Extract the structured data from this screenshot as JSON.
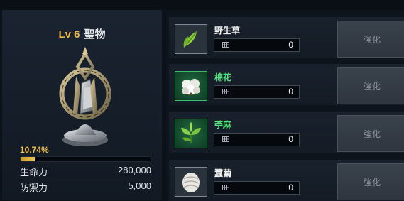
{
  "relic": {
    "level": "Lv 6",
    "name": "聖物",
    "progress_text": "10.74%",
    "progress_fraction": 0.1074,
    "stats": [
      {
        "label": "生命力",
        "value": "280,000"
      },
      {
        "label": "防禦力",
        "value": "5,000"
      }
    ]
  },
  "materials": [
    {
      "name": "野生草",
      "count": "0",
      "grade_color": "#7f8a97",
      "icon": "wild-grass-icon",
      "button": "強化"
    },
    {
      "name": "棉花",
      "count": "0",
      "grade_color": "#3bbf6a",
      "icon": "cotton-icon",
      "button": "強化"
    },
    {
      "name": "苧麻",
      "count": "0",
      "grade_color": "#3bbf6a",
      "icon": "ramie-icon",
      "button": "強化"
    },
    {
      "name": "蠶繭",
      "count": "0",
      "grade_color": "#7f8a97",
      "icon": "cocoon-icon",
      "button": "強化"
    }
  ]
}
